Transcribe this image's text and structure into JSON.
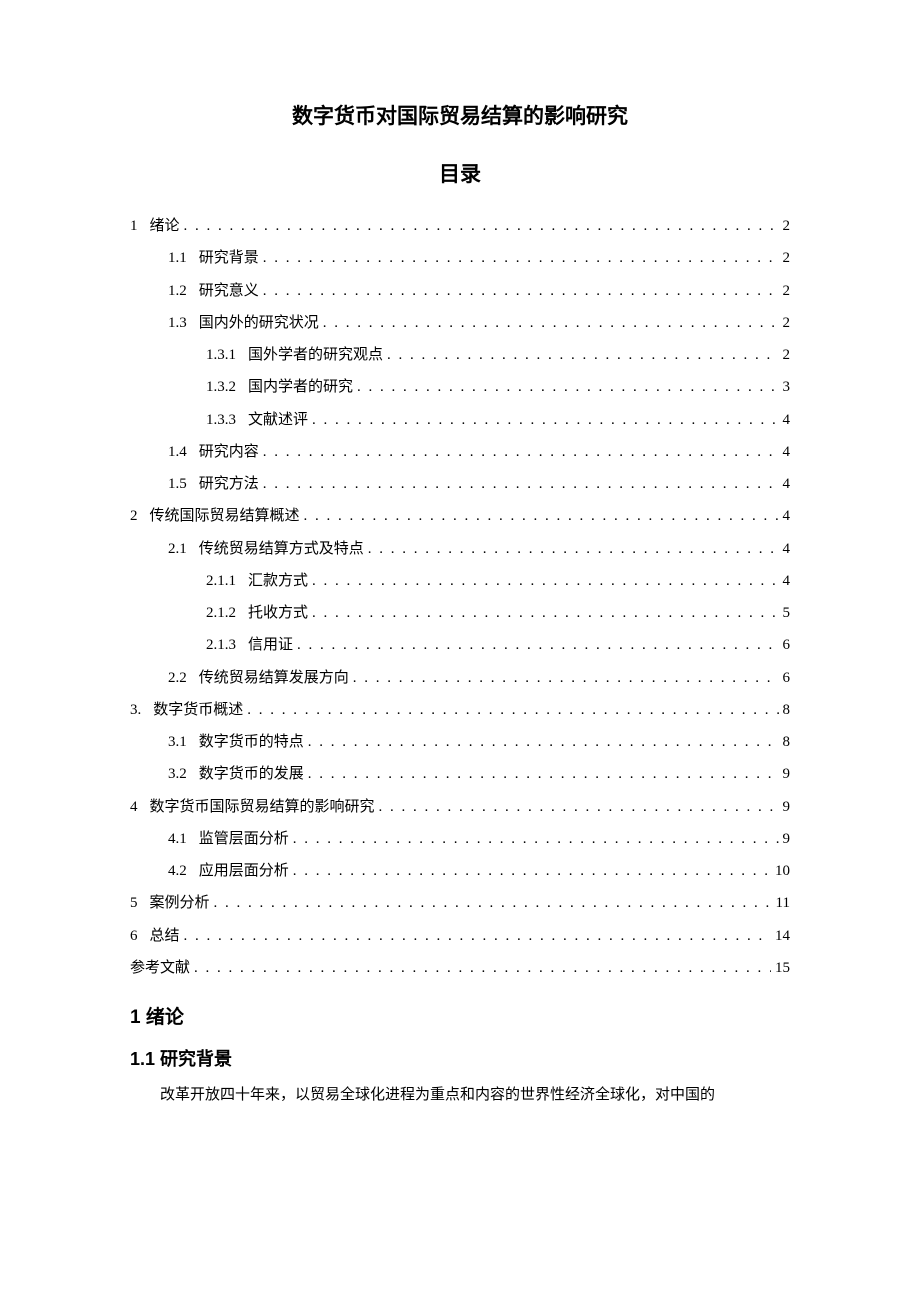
{
  "title": "数字货币对国际贸易结算的影响研究",
  "tocHeading": "目录",
  "toc": [
    {
      "level": 0,
      "num": "1",
      "label": "绪论",
      "page": "2"
    },
    {
      "level": 1,
      "num": "1.1",
      "label": "研究背景",
      "page": "2"
    },
    {
      "level": 1,
      "num": "1.2",
      "label": "研究意义",
      "page": "2"
    },
    {
      "level": 1,
      "num": "1.3",
      "label": "国内外的研究状况",
      "page": "2"
    },
    {
      "level": 2,
      "num": "1.3.1",
      "label": "国外学者的研究观点",
      "page": "2"
    },
    {
      "level": 2,
      "num": "1.3.2",
      "label": "国内学者的研究",
      "page": "3"
    },
    {
      "level": 2,
      "num": "1.3.3",
      "label": "文献述评",
      "page": "4"
    },
    {
      "level": 1,
      "num": "1.4",
      "label": "研究内容",
      "page": "4"
    },
    {
      "level": 1,
      "num": "1.5",
      "label": "研究方法",
      "page": "4"
    },
    {
      "level": 0,
      "num": "2",
      "label": "传统国际贸易结算概述",
      "page": "4"
    },
    {
      "level": 1,
      "num": "2.1",
      "label": "传统贸易结算方式及特点",
      "page": "4"
    },
    {
      "level": 2,
      "num": "2.1.1",
      "label": "汇款方式",
      "page": "4"
    },
    {
      "level": 2,
      "num": "2.1.2",
      "label": "托收方式",
      "page": "5"
    },
    {
      "level": 2,
      "num": "2.1.3",
      "label": "信用证",
      "page": "6"
    },
    {
      "level": 1,
      "num": "2.2",
      "label": "传统贸易结算发展方向",
      "page": "6"
    },
    {
      "level": 0,
      "num": "3.",
      "label": "数字货币概述",
      "page": "8"
    },
    {
      "level": 1,
      "num": "3.1",
      "label": "数字货币的特点",
      "page": "8"
    },
    {
      "level": 1,
      "num": "3.2",
      "label": "数字货币的发展",
      "page": "9"
    },
    {
      "level": 0,
      "num": "4",
      "label": "数字货币国际贸易结算的影响研究",
      "page": "9"
    },
    {
      "level": 1,
      "num": "4.1",
      "label": "监管层面分析",
      "page": "9"
    },
    {
      "level": 1,
      "num": "4.2",
      "label": "应用层面分析",
      "page": "10"
    },
    {
      "level": 0,
      "num": "5",
      "label": "案例分析",
      "page": "11"
    },
    {
      "level": 0,
      "num": "6",
      "label": "总结",
      "page": "14"
    },
    {
      "level": 0,
      "num": "",
      "label": "参考文献",
      "page": "15"
    }
  ],
  "section1": {
    "num": "1",
    "title": "绪论"
  },
  "section11": {
    "num": "1.1",
    "title": "研究背景"
  },
  "bodyParagraph": "改革开放四十年来，以贸易全球化进程为重点和内容的世界性经济全球化，对中国的"
}
